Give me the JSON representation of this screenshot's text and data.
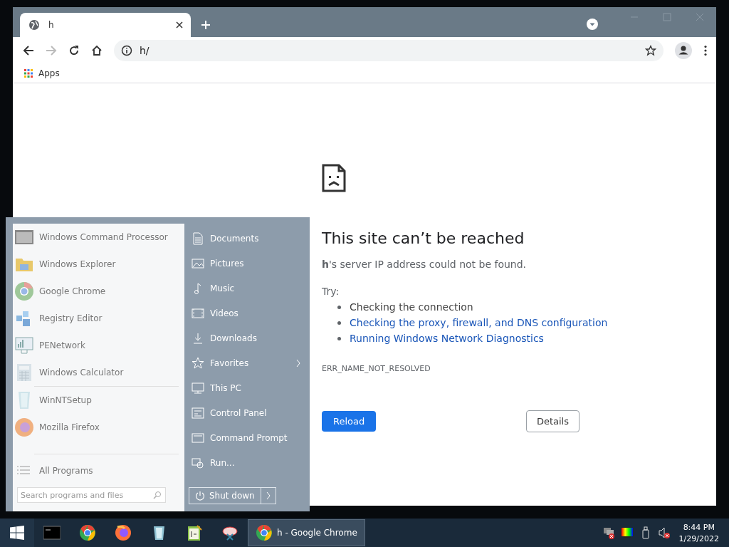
{
  "browser": {
    "tab_title": "h",
    "address": "h/",
    "bookmarks": [
      "Apps"
    ]
  },
  "error_page": {
    "title": "This site can’t be reached",
    "message": "**h**'s server IP address could not be found.",
    "try_label": "Try:",
    "suggestions": [
      {
        "text": "Checking the connection",
        "kind": "text"
      },
      {
        "text": "Checking the proxy, firewall, and DNS configuration",
        "kind": "link"
      },
      {
        "text": "Running Windows Network Diagnostics",
        "kind": "link"
      }
    ],
    "error_code": "ERR_NAME_NOT_RESOLVED",
    "reload": "Reload",
    "details": "Details"
  },
  "start_menu": {
    "programs": [
      {
        "name": "Windows Command Processor"
      },
      {
        "name": "Windows Explorer"
      },
      {
        "name": "Google Chrome"
      },
      {
        "name": "Registry Editor"
      },
      {
        "name": "PENetwork"
      },
      {
        "name": "Windows Calculator"
      },
      {
        "name": "WinNTSetup"
      },
      {
        "name": "Mozilla Firefox"
      }
    ],
    "all_programs": "All Programs",
    "search": {
      "placeholder": "Search programs and files"
    },
    "places": [
      {
        "label": "Documents",
        "submenu": false
      },
      {
        "label": "Pictures",
        "submenu": false
      },
      {
        "label": "Music",
        "submenu": false
      },
      {
        "label": "Videos",
        "submenu": false
      },
      {
        "label": "Downloads",
        "submenu": false
      },
      {
        "label": "Favorites",
        "submenu": true
      },
      {
        "label": "This PC",
        "submenu": false
      },
      {
        "label": "Control Panel",
        "submenu": false
      },
      {
        "label": "Command Prompt",
        "submenu": false
      },
      {
        "label": "Run...",
        "submenu": false
      }
    ],
    "shutdown": "Shut down"
  },
  "taskbar": {
    "windows": [
      {
        "title": "h - Google Chrome",
        "selected": true
      }
    ],
    "time": "8:44 PM",
    "date": "1/29/2022"
  }
}
